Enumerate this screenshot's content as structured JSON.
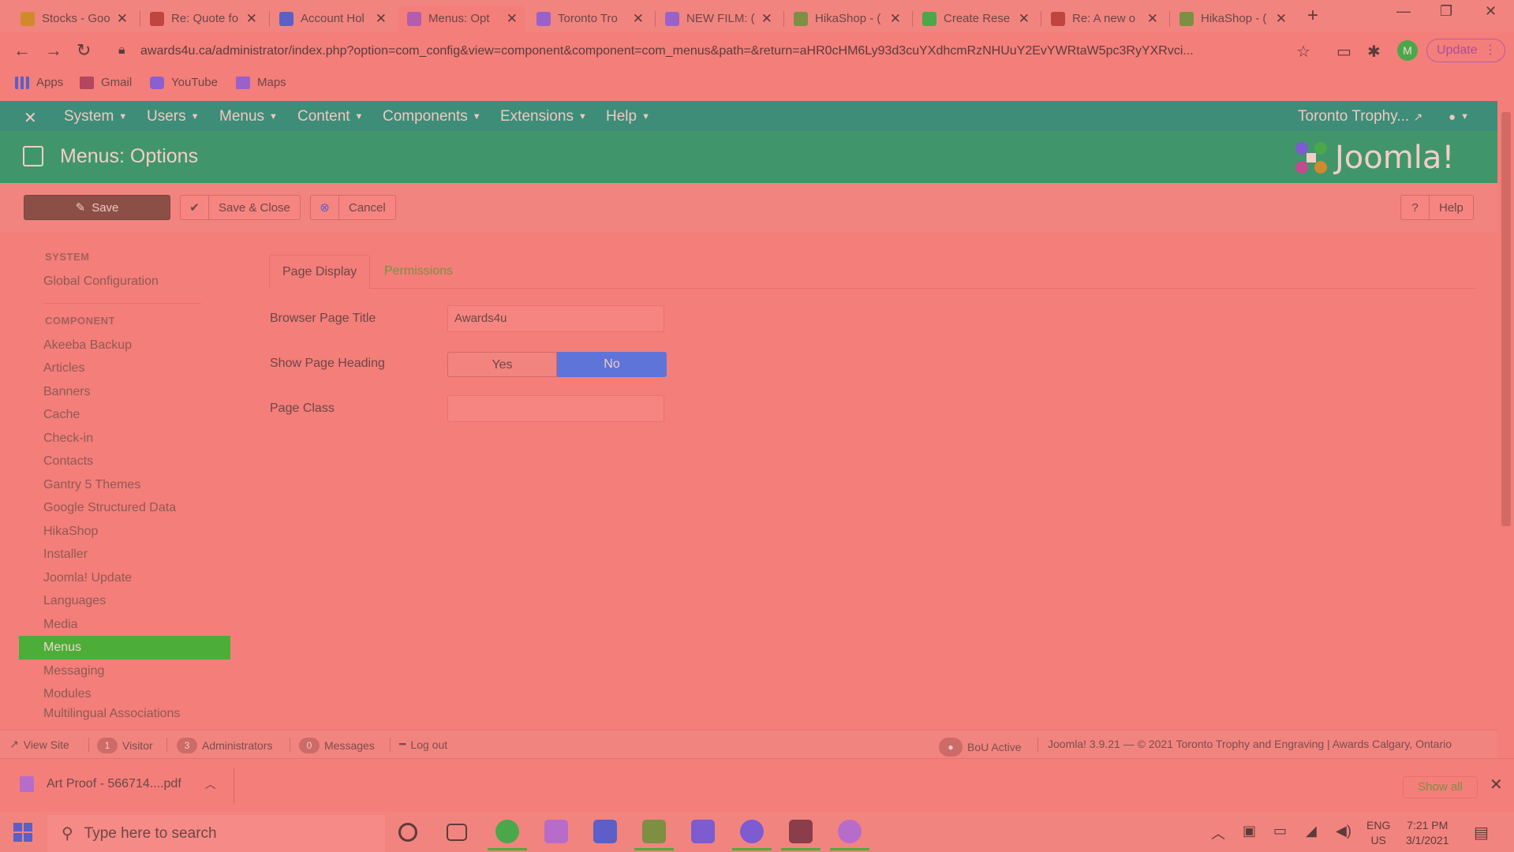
{
  "browser": {
    "tabs": [
      {
        "label": "Stocks - Goo",
        "color": "#d08a2c"
      },
      {
        "label": "Re: Quote fo",
        "color": "#c0453f"
      },
      {
        "label": "Account Hol",
        "color": "#5b5fc7"
      },
      {
        "label": "Menus: Opt",
        "color": "#b55dac",
        "active": true
      },
      {
        "label": "Toronto Tro",
        "color": "#9a62c8"
      },
      {
        "label": "NEW FILM: (",
        "color": "#9a62c8"
      },
      {
        "label": "HikaShop - (",
        "color": "#7d8f42"
      },
      {
        "label": "Create Rese",
        "color": "#4aa84a"
      },
      {
        "label": "Re: A new o",
        "color": "#c0453f"
      },
      {
        "label": "HikaShop - (",
        "color": "#7d8f42"
      }
    ],
    "url": "awards4u.ca/administrator/index.php?option=com_config&view=component&component=com_menus&path=&return=aHR0cHM6Ly93d3cuYXdhcmRzNHUuY2EvYWRtaW5pc3RyYXRvci...",
    "profile_initial": "M",
    "update_label": "Update",
    "bookmarks": [
      {
        "label": "Apps"
      },
      {
        "label": "Gmail"
      },
      {
        "label": "YouTube"
      },
      {
        "label": "Maps"
      }
    ]
  },
  "joomla": {
    "menu": [
      "System",
      "Users",
      "Menus",
      "Content",
      "Components",
      "Extensions",
      "Help"
    ],
    "site_name": "Toronto Trophy...",
    "page_title": "Menus: Options",
    "logo_text": "Joomla!",
    "toolbar": {
      "save": "Save",
      "save_close": "Save & Close",
      "cancel": "Cancel",
      "help": "Help"
    },
    "sidebar": {
      "system_heading": "SYSTEM",
      "system_items": [
        "Global Configuration"
      ],
      "component_heading": "COMPONENT",
      "component_items": [
        "Akeeba Backup",
        "Articles",
        "Banners",
        "Cache",
        "Check-in",
        "Contacts",
        "Gantry 5 Themes",
        "Google Structured Data",
        "HikaShop",
        "Installer",
        "Joomla! Update",
        "Languages",
        "Media",
        "Menus",
        "Messaging",
        "Modules",
        "Multilingual Associations"
      ],
      "active_item": "Menus"
    },
    "tabs": {
      "page_display": "Page Display",
      "permissions": "Permissions"
    },
    "form": {
      "browser_page_title_label": "Browser Page Title",
      "browser_page_title_value": "Awards4u",
      "show_heading_label": "Show Page Heading",
      "yes": "Yes",
      "no": "No",
      "show_heading_selected": "No",
      "page_class_label": "Page Class",
      "page_class_value": ""
    },
    "status": {
      "view_site": "View Site",
      "visitor_count": "1",
      "visitor_label": "Visitor",
      "admin_count": "3",
      "admin_label": "Administrators",
      "messages_count": "0",
      "messages_label": "Messages",
      "logout": "Log out",
      "bou": "BoU Active",
      "footer": "Joomla! 3.9.21 — © 2021 Toronto Trophy and Engraving | Awards Calgary, Ontario"
    }
  },
  "downloads": {
    "file": "Art Proof - 566714....pdf",
    "show_all": "Show all"
  },
  "taskbar": {
    "search_placeholder": "Type here to search",
    "lang_top": "ENG",
    "lang_bottom": "US",
    "time": "7:21 PM",
    "date": "3/1/2021"
  }
}
